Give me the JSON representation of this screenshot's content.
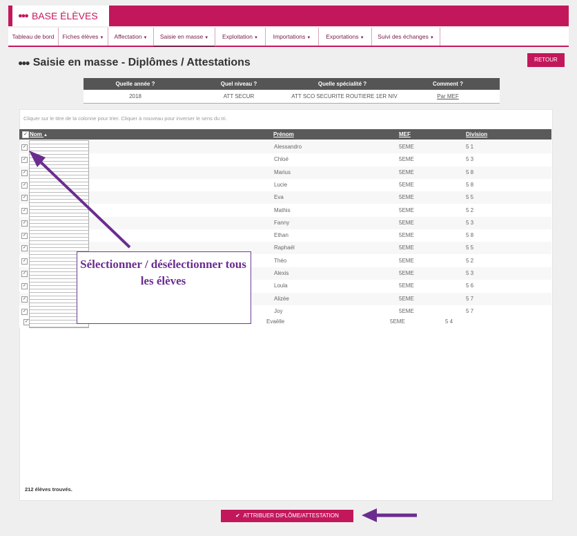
{
  "app": {
    "brand": "BASE ÉLÈVES"
  },
  "nav": [
    {
      "label": "Tableau de bord",
      "caret": false
    },
    {
      "label": "Fiches élèves",
      "caret": true
    },
    {
      "label": "Affectation",
      "caret": true
    },
    {
      "label": "Saisie en masse",
      "caret": true
    },
    {
      "label": "Exploitation",
      "caret": true
    },
    {
      "label": "Importations",
      "caret": true
    },
    {
      "label": "Exportations",
      "caret": true
    },
    {
      "label": "Suivi des échanges",
      "caret": true
    }
  ],
  "page": {
    "title": "Saisie en masse - Diplômes / Attestations",
    "back_label": "RETOUR"
  },
  "summary": {
    "headers": [
      "Quelle année ?",
      "Quel niveau ?",
      "Quelle spécialité ?",
      "Comment ?"
    ],
    "values": [
      "2018",
      "ATT SECUR",
      "ATT SCO SECURITE ROUTIERE 1ER NIV",
      "Par MEF"
    ]
  },
  "table": {
    "hint": "Cliquer sur le titre de la colonne pour trier. Cliquer à nouveau pour inverser le sens du tri.",
    "columns": {
      "nom": "Nom",
      "sort_indicator": "▲",
      "prenom": "Prénom",
      "mef": "MEF",
      "division": "Division"
    },
    "rows": [
      {
        "prenom": "Alessandro",
        "mef": "5EME",
        "division": "5 1"
      },
      {
        "prenom": "Chloé",
        "mef": "5EME",
        "division": "5 3"
      },
      {
        "prenom": "Marius",
        "mef": "5EME",
        "division": "5 8"
      },
      {
        "prenom": "Lucie",
        "mef": "5EME",
        "division": "5 8"
      },
      {
        "prenom": "Eva",
        "mef": "5EME",
        "division": "5 5"
      },
      {
        "prenom": "Mathis",
        "mef": "5EME",
        "division": "5 2"
      },
      {
        "prenom": "Fanny",
        "mef": "5EME",
        "division": "5 3"
      },
      {
        "prenom": "Ethan",
        "mef": "5EME",
        "division": "5 8"
      },
      {
        "prenom": "Raphaël",
        "mef": "5EME",
        "division": "5 5"
      },
      {
        "prenom": "Théo",
        "mef": "5EME",
        "division": "5 2"
      },
      {
        "prenom": "Alexis",
        "mef": "5EME",
        "division": "5 3"
      },
      {
        "prenom": "Loula",
        "mef": "5EME",
        "division": "5 6"
      },
      {
        "prenom": "Alizée",
        "mef": "5EME",
        "division": "5 7"
      },
      {
        "prenom": "Joy",
        "mef": "5EME",
        "division": "5 7"
      }
    ],
    "extra_row": {
      "prenom": "Evaëlle",
      "mef": "5EME",
      "division": "5 4"
    },
    "found_text": "212 élèves trouvés."
  },
  "action": {
    "label": "ATTRIBUER DIPLÔME/ATTESTATION",
    "icon": "check-icon"
  },
  "annotation": {
    "text": "Sélectionner / désélectionner tous les élèves"
  },
  "colors": {
    "accent": "#c2185b",
    "header_dark": "#5a5a5a",
    "annotation": "#6a2d8f"
  }
}
